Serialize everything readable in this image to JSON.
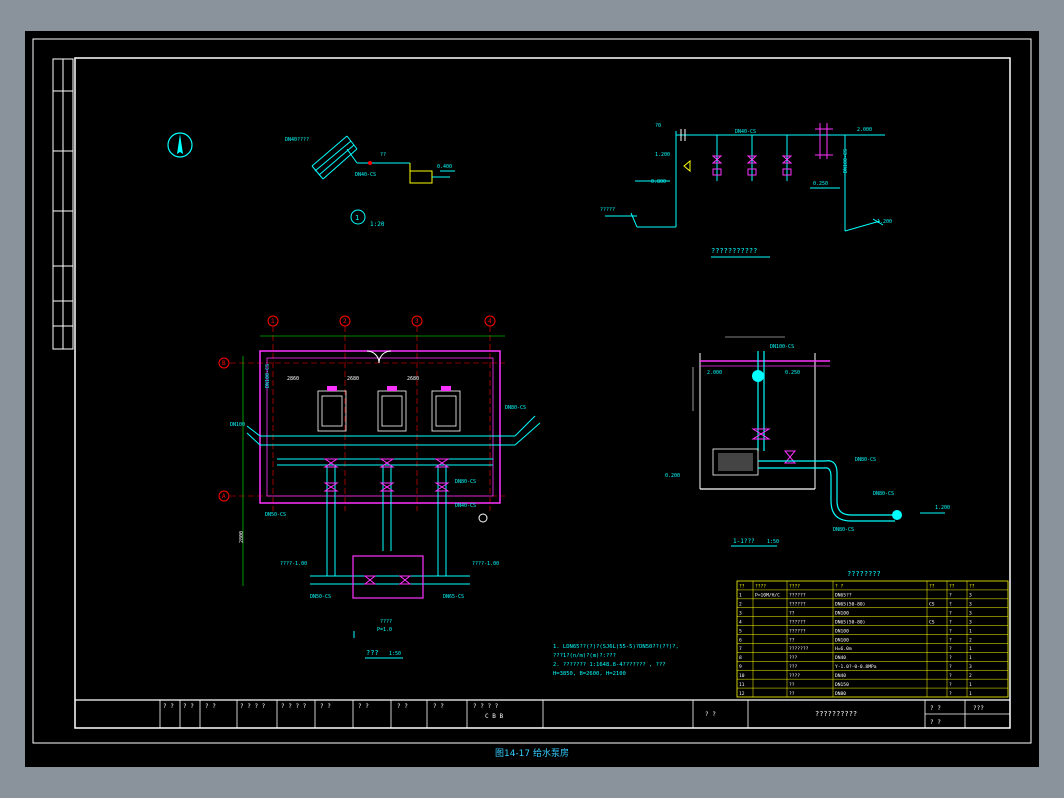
{
  "drawing": {
    "caption": "图14-17 给水泵房",
    "scale_label_1": "1:20",
    "legend_section_title": "???????????",
    "section_label": "1-1???",
    "section_scale": "1:50",
    "plan_label": "???",
    "plan_scale": "1:50",
    "material_table_title": "????????",
    "notes": [
      "1. LDN65??(?)?(SJ6L)55-5)?DN50??(??)?,",
      "   ???1?(n/m)?(m)?:???",
      "2. ??????? 1:1648.8-4??????? , ???",
      "   H=3850,  B=2600,  H=2100"
    ],
    "pipe_labels": {
      "dn_top": "DN40-CS",
      "dn_mid": "DN100-CS",
      "dn_left": "DN50-CS",
      "dn_bottom": "DN65-CS",
      "dn_right": "DN80-CS"
    },
    "elevations": [
      "2.000",
      "1.200",
      "0.800",
      "0.250",
      "0.400"
    ],
    "axis_labels_top": [
      "1",
      "2",
      "3",
      "4"
    ],
    "axis_labels_left": [
      "B",
      "A"
    ]
  },
  "material_table": {
    "headers": [
      "??",
      "????",
      "????",
      "? ?",
      "??",
      "??",
      "??"
    ],
    "rows": [
      [
        "1",
        "P=10M/H/C",
        "??????",
        "DN65??",
        "",
        "?",
        "3"
      ],
      [
        "2",
        "",
        "??????",
        "DN65(50-80)",
        "CS",
        "?",
        "3"
      ],
      [
        "3",
        "",
        "??",
        "DN100",
        "",
        "?",
        "3"
      ],
      [
        "4",
        "",
        "??????",
        "DN65(50-80)",
        "CS",
        "?",
        "3"
      ],
      [
        "5",
        "",
        "??????",
        "DN100",
        "",
        "?",
        "1"
      ],
      [
        "6",
        "",
        "??",
        "DN100",
        "",
        "?",
        "2"
      ],
      [
        "7",
        "",
        "???????",
        "H=6.0m",
        "",
        "?",
        "1"
      ],
      [
        "8",
        "",
        "???",
        "DN40",
        "",
        "?",
        "1"
      ],
      [
        "9",
        "",
        "???",
        "Y-1.0?-0-0.8MPa",
        "",
        "?",
        "3"
      ],
      [
        "10",
        "",
        "????",
        "DN40",
        "",
        "?",
        "2"
      ],
      [
        "11",
        "",
        "??",
        "DN150",
        "",
        "?",
        "1"
      ],
      [
        "12",
        "",
        "??",
        "DN80",
        "",
        "?",
        "1"
      ]
    ]
  },
  "title_block": {
    "cells": [
      "? ?",
      "? ?",
      "? ?",
      "? ? ? ?",
      "? ? ? ?",
      "? ?",
      "? ?",
      "? ?",
      "? ?",
      "? ? ? ?"
    ],
    "stamp": "C B B",
    "stage": "? ?",
    "drawing_name": "??????????",
    "right_cells": [
      "? ?",
      "???",
      "? ?"
    ]
  },
  "colors": {
    "sheet_bg": "#000000",
    "frame": "#ffffff",
    "cyan": "#00ffff",
    "magenta": "#ff33ff",
    "yellow": "#ffff00",
    "red": "#ff2020",
    "green": "#00ff00",
    "white": "#ffffff"
  }
}
